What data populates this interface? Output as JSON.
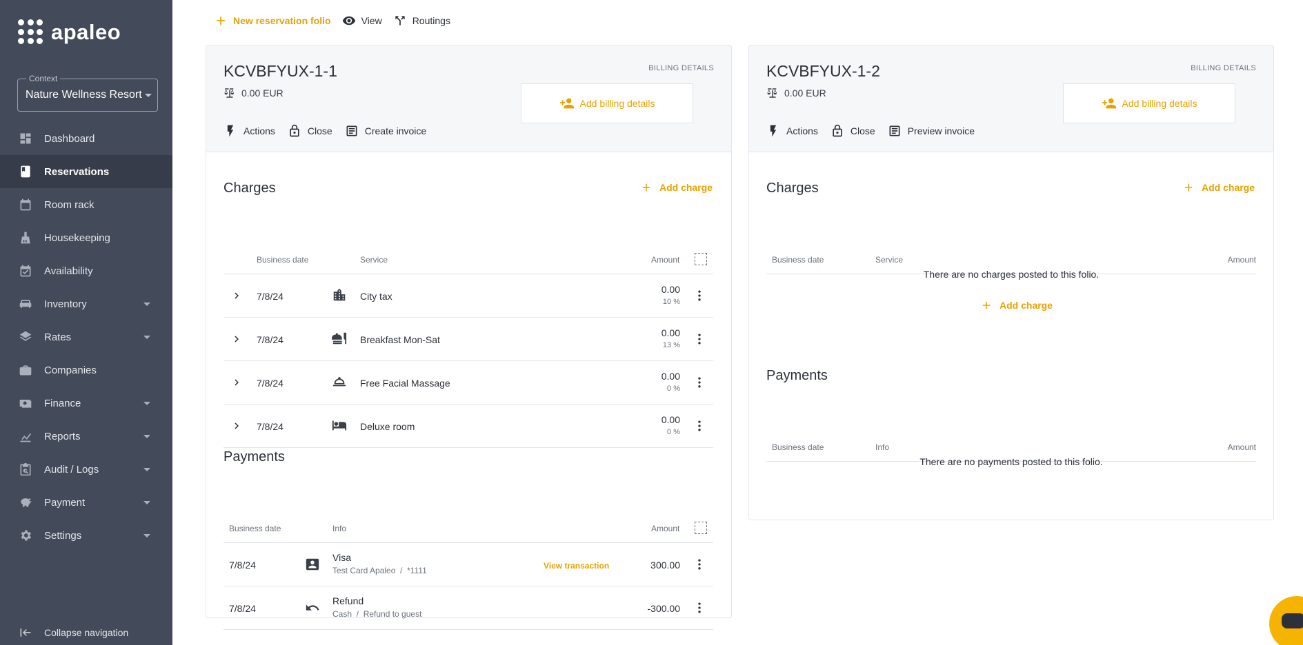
{
  "sidebar": {
    "logo_text": "apaleo",
    "context_label": "Context",
    "context_value": "Nature Wellness Resort",
    "items": [
      {
        "label": "Dashboard",
        "icon": "dashboard-icon"
      },
      {
        "label": "Reservations",
        "icon": "reservations-icon"
      },
      {
        "label": "Room rack",
        "icon": "calendar-icon"
      },
      {
        "label": "Housekeeping",
        "icon": "broom-icon"
      },
      {
        "label": "Availability",
        "icon": "calendar-check-icon"
      },
      {
        "label": "Inventory",
        "icon": "car-icon"
      },
      {
        "label": "Rates",
        "icon": "layers-icon"
      },
      {
        "label": "Companies",
        "icon": "briefcase-icon"
      },
      {
        "label": "Finance",
        "icon": "money-icon"
      },
      {
        "label": "Reports",
        "icon": "chart-icon"
      },
      {
        "label": "Audit / Logs",
        "icon": "clipboard-search-icon"
      },
      {
        "label": "Payment",
        "icon": "piggy-bank-icon"
      },
      {
        "label": "Settings",
        "icon": "gear-icon"
      }
    ],
    "collapse_label": "Collapse navigation"
  },
  "toolbar": {
    "new_folio": "New reservation folio",
    "view": "View",
    "routings": "Routings"
  },
  "folio1": {
    "title": "KCVBFYUX-1-1",
    "balance": "0.00 EUR",
    "billing_label": "BILLING DETAILS",
    "add_billing": "Add billing details",
    "actions": "Actions",
    "close": "Close",
    "invoice": "Create invoice",
    "charges_title": "Charges",
    "add_charge": "Add charge",
    "charges_headers": {
      "date": "Business date",
      "service": "Service",
      "amount": "Amount"
    },
    "charges": [
      {
        "date": "7/8/24",
        "service": "City tax",
        "amount": "0.00",
        "pct": "10 %"
      },
      {
        "date": "7/8/24",
        "service": "Breakfast Mon-Sat",
        "amount": "0.00",
        "pct": "13 %"
      },
      {
        "date": "7/8/24",
        "service": "Free Facial Massage",
        "amount": "0.00",
        "pct": "0 %"
      },
      {
        "date": "7/8/24",
        "service": "Deluxe room",
        "amount": "0.00",
        "pct": "0 %"
      }
    ],
    "payments_title": "Payments",
    "payments_headers": {
      "date": "Business date",
      "info": "Info",
      "amount": "Amount"
    },
    "payments": [
      {
        "date": "7/8/24",
        "info": "Visa",
        "sub1": "Test Card Apaleo",
        "sub2": "*1111",
        "link": "View transaction",
        "amount": "300.00"
      },
      {
        "date": "7/8/24",
        "info": "Refund",
        "sub1": "Cash",
        "sub2": "Refund to guest",
        "link": "",
        "amount": "-300.00"
      }
    ]
  },
  "folio2": {
    "title": "KCVBFYUX-1-2",
    "balance": "0.00 EUR",
    "billing_label": "BILLING DETAILS",
    "add_billing": "Add billing details",
    "actions": "Actions",
    "close": "Close",
    "invoice": "Preview invoice",
    "charges_title": "Charges",
    "add_charge": "Add charge",
    "charges_headers": {
      "date": "Business date",
      "service": "Service",
      "amount": "Amount"
    },
    "no_charges": "There are no charges posted to this folio.",
    "empty_add_charge": "Add charge",
    "payments_title": "Payments",
    "payments_headers": {
      "date": "Business date",
      "info": "Info",
      "amount": "Amount"
    },
    "no_payments": "There are no payments posted to this folio."
  },
  "colors": {
    "accent": "#e8a200",
    "sidebar": "#434a59",
    "sidebar_active": "#363c49"
  }
}
